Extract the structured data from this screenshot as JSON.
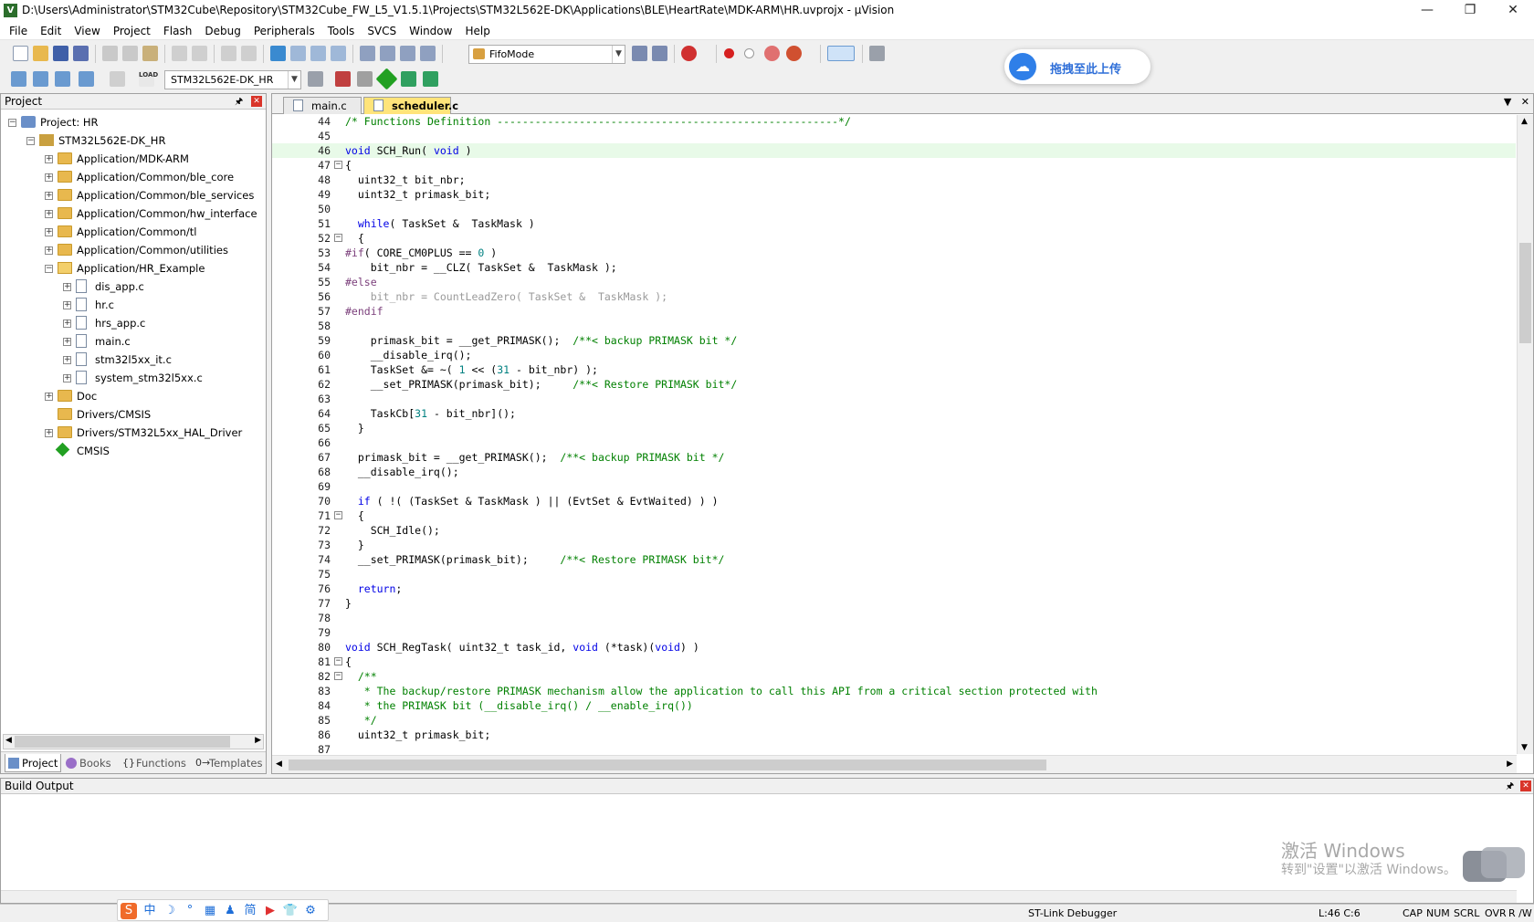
{
  "window": {
    "title": "D:\\Users\\Administrator\\STM32Cube\\Repository\\STM32Cube_FW_L5_V1.5.1\\Projects\\STM32L562E-DK\\Applications\\BLE\\HeartRate\\MDK-ARM\\HR.uvprojx - µVision",
    "icon": "V",
    "minimize": "—",
    "restore": "❐",
    "close": "✕"
  },
  "menu": [
    "File",
    "Edit",
    "View",
    "Project",
    "Flash",
    "Debug",
    "Peripherals",
    "Tools",
    "SVCS",
    "Window",
    "Help"
  ],
  "toolbar": {
    "find_combo": "FifoMode",
    "target_combo": "STM32L562E-DK_HR",
    "load_label": "LOAD"
  },
  "baidu": {
    "label": "拖拽至此上传"
  },
  "project_pane": {
    "title": "Project",
    "tree": [
      {
        "label": "Project: HR",
        "level": 0,
        "type": "project",
        "expander": "−"
      },
      {
        "label": "STM32L562E-DK_HR",
        "level": 1,
        "type": "target",
        "expander": "−"
      },
      {
        "label": "Application/MDK-ARM",
        "level": 2,
        "type": "folder",
        "expander": "+"
      },
      {
        "label": "Application/Common/ble_core",
        "level": 2,
        "type": "folder",
        "expander": "+"
      },
      {
        "label": "Application/Common/ble_services",
        "level": 2,
        "type": "folder",
        "expander": "+"
      },
      {
        "label": "Application/Common/hw_interface",
        "level": 2,
        "type": "folder",
        "expander": "+"
      },
      {
        "label": "Application/Common/tl",
        "level": 2,
        "type": "folder",
        "expander": "+"
      },
      {
        "label": "Application/Common/utilities",
        "level": 2,
        "type": "folder",
        "expander": "+"
      },
      {
        "label": "Application/HR_Example",
        "level": 2,
        "type": "folder-open",
        "expander": "−"
      },
      {
        "label": "dis_app.c",
        "level": 3,
        "type": "file",
        "expander": "+"
      },
      {
        "label": "hr.c",
        "level": 3,
        "type": "file",
        "expander": "+"
      },
      {
        "label": "hrs_app.c",
        "level": 3,
        "type": "file",
        "expander": "+"
      },
      {
        "label": "main.c",
        "level": 3,
        "type": "file",
        "expander": "+"
      },
      {
        "label": "stm32l5xx_it.c",
        "level": 3,
        "type": "file",
        "expander": "+"
      },
      {
        "label": "system_stm32l5xx.c",
        "level": 3,
        "type": "file",
        "expander": "+"
      },
      {
        "label": "Doc",
        "level": 2,
        "type": "folder",
        "expander": "+"
      },
      {
        "label": "Drivers/CMSIS",
        "level": 2,
        "type": "folder",
        "expander": ""
      },
      {
        "label": "Drivers/STM32L5xx_HAL_Driver",
        "level": 2,
        "type": "folder",
        "expander": "+"
      },
      {
        "label": "CMSIS",
        "level": 2,
        "type": "component",
        "expander": ""
      }
    ],
    "tabs": [
      "Project",
      "Books",
      "Functions",
      "Templates"
    ]
  },
  "editor": {
    "tabs": [
      "main.c",
      "scheduler.c"
    ],
    "active_tab": 1,
    "current_line": 46,
    "lines": [
      {
        "n": 44,
        "t": "/* Functions Definition ------------------------------------------------------*/"
      },
      {
        "n": 45,
        "t": ""
      },
      {
        "n": 46,
        "t": "void SCH_Run( void )"
      },
      {
        "n": 47,
        "t": "{",
        "fold": "−"
      },
      {
        "n": 48,
        "t": "  uint32_t bit_nbr;"
      },
      {
        "n": 49,
        "t": "  uint32_t primask_bit;"
      },
      {
        "n": 50,
        "t": ""
      },
      {
        "n": 51,
        "t": "  while( TaskSet &  TaskMask )"
      },
      {
        "n": 52,
        "t": "  {",
        "fold": "−"
      },
      {
        "n": 53,
        "t": "#if( CORE_CM0PLUS == 0 )"
      },
      {
        "n": 54,
        "t": "    bit_nbr = __CLZ( TaskSet &  TaskMask );"
      },
      {
        "n": 55,
        "t": "#else"
      },
      {
        "n": 56,
        "t": "    bit_nbr = CountLeadZero( TaskSet &  TaskMask );"
      },
      {
        "n": 57,
        "t": "#endif"
      },
      {
        "n": 58,
        "t": ""
      },
      {
        "n": 59,
        "t": "    primask_bit = __get_PRIMASK();  /**< backup PRIMASK bit */"
      },
      {
        "n": 60,
        "t": "    __disable_irq();"
      },
      {
        "n": 61,
        "t": "    TaskSet &= ~( 1 << (31 - bit_nbr) );"
      },
      {
        "n": 62,
        "t": "    __set_PRIMASK(primask_bit);     /**< Restore PRIMASK bit*/"
      },
      {
        "n": 63,
        "t": ""
      },
      {
        "n": 64,
        "t": "    TaskCb[31 - bit_nbr]();"
      },
      {
        "n": 65,
        "t": "  }"
      },
      {
        "n": 66,
        "t": ""
      },
      {
        "n": 67,
        "t": "  primask_bit = __get_PRIMASK();  /**< backup PRIMASK bit */"
      },
      {
        "n": 68,
        "t": "  __disable_irq();"
      },
      {
        "n": 69,
        "t": ""
      },
      {
        "n": 70,
        "t": "  if ( !( (TaskSet & TaskMask ) || (EvtSet & EvtWaited) ) )"
      },
      {
        "n": 71,
        "t": "  {",
        "fold": "−"
      },
      {
        "n": 72,
        "t": "    SCH_Idle();"
      },
      {
        "n": 73,
        "t": "  }"
      },
      {
        "n": 74,
        "t": "  __set_PRIMASK(primask_bit);     /**< Restore PRIMASK bit*/"
      },
      {
        "n": 75,
        "t": ""
      },
      {
        "n": 76,
        "t": "  return;"
      },
      {
        "n": 77,
        "t": "}"
      },
      {
        "n": 78,
        "t": ""
      },
      {
        "n": 79,
        "t": ""
      },
      {
        "n": 80,
        "t": "void SCH_RegTask( uint32_t task_id, void (*task)(void) )"
      },
      {
        "n": 81,
        "t": "{",
        "fold": "−"
      },
      {
        "n": 82,
        "t": "  /**",
        "fold": "−"
      },
      {
        "n": 83,
        "t": "   * The backup/restore PRIMASK mechanism allow the application to call this API from a critical section protected with"
      },
      {
        "n": 84,
        "t": "   * the PRIMASK bit (__disable_irq() / __enable_irq())"
      },
      {
        "n": 85,
        "t": "   */"
      },
      {
        "n": 86,
        "t": "  uint32_t primask_bit;"
      },
      {
        "n": 87,
        "t": ""
      }
    ]
  },
  "build_output": {
    "title": "Build Output"
  },
  "watermark": {
    "line1": "激活 Windows",
    "line2": "转到\"设置\"以激活 Windows。"
  },
  "status": {
    "debugger": "ST-Link Debugger",
    "position": "L:46 C:6",
    "caps": "CAP",
    "num": "NUM",
    "scrl": "SCRL",
    "ovr": "OVR",
    "rw": "R /W"
  },
  "ime": {
    "items": [
      "中",
      "☽",
      "°",
      "▦",
      "♟",
      "简",
      "▶",
      "👕",
      "⚙"
    ]
  },
  "colors": {
    "keyword": "#0000e6",
    "comment": "#008000",
    "preprocessor": "#7b3f7b",
    "number": "#008080",
    "inactive": "#9a9a9a",
    "active_tab": "#ffe47a",
    "current_line": "#e8fae8"
  }
}
